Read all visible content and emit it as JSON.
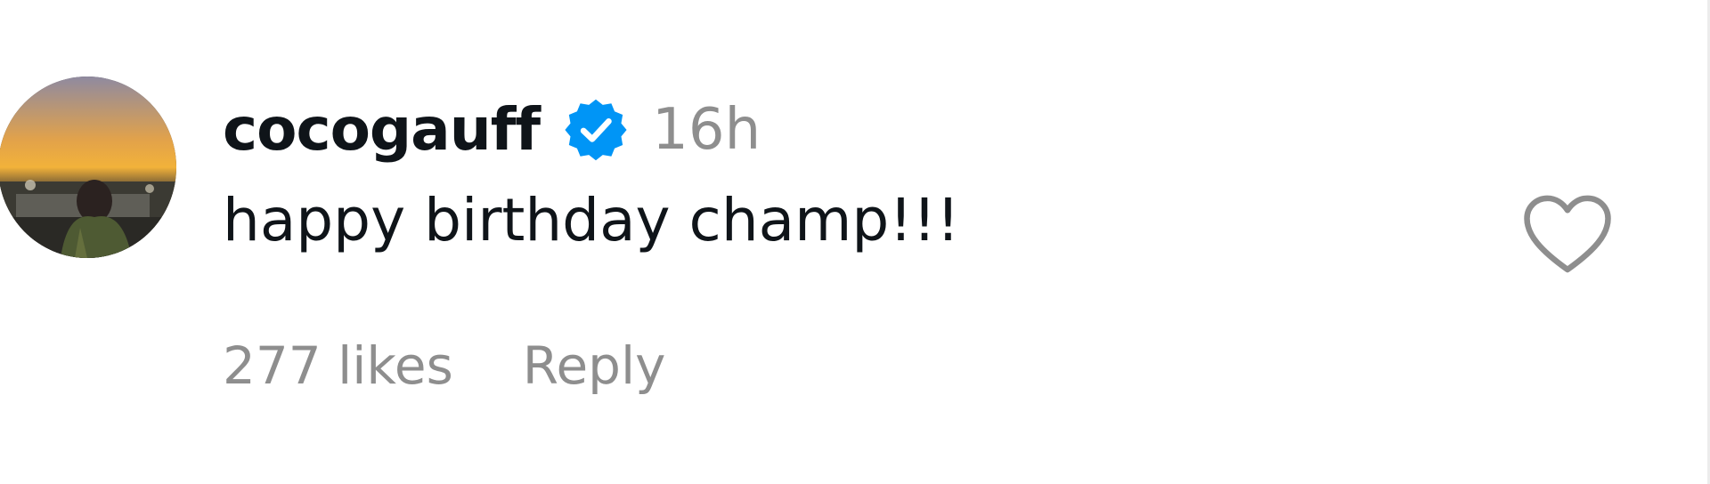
{
  "comment": {
    "username": "cocogauff",
    "verified": true,
    "timestamp": "16h",
    "text": "happy birthday champ!!!",
    "likes_label": "277 likes",
    "reply_label": "Reply"
  },
  "icons": {
    "verified": "verified-badge-icon",
    "like": "heart-outline-icon"
  },
  "colors": {
    "username": "#0f1419",
    "text": "#0f1419",
    "muted": "#8e8e8e",
    "verified_blue": "#0095f6",
    "heart_outline": "#8e8e8e"
  }
}
